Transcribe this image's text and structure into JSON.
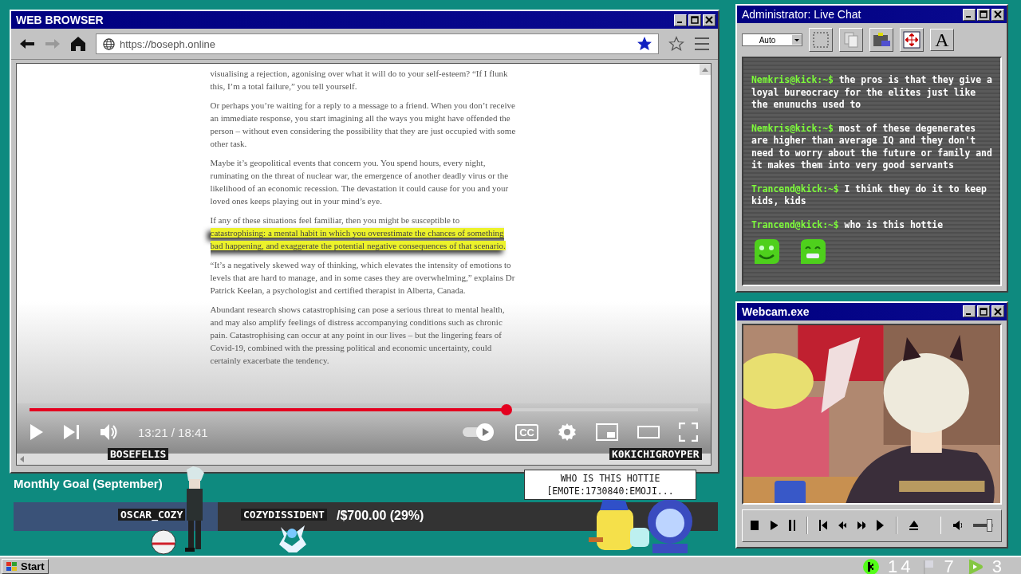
{
  "browser": {
    "title": "WEB BROWSER",
    "url": "https://boseph.online",
    "bookmarked": true,
    "article": [
      {
        "text": "visualising a rejection, agonising over what it will do to your self-esteem? “If I flunk this, I’m a total failure,” you tell yourself."
      },
      {
        "text": "Or perhaps you’re waiting for a reply to a message to a friend. When you don’t receive an immediate response, you start imagining all the ways you might have offended the person – without even considering the possibility that they are just occupied with some other task."
      },
      {
        "text": "Maybe it’s geopolitical events that concern you. You spend hours, every night, ruminating on the threat of nuclear war, the emergence of another deadly virus or the likelihood of an economic recession. The devastation it could cause for you and your loved ones keeps playing out in your mind’s eye."
      },
      {
        "text": "If any of these situations feel familiar, then you might be susceptible to",
        "highlight": "catastrophising: a mental habit in which you overestimate the chances of something bad happening, and exaggerate the potential negative consequences of that scenario."
      },
      {
        "text": "“It’s a negatively skewed way of thinking, which elevates the intensity of emotions to levels that are hard to manage, and in some cases they are overwhelming,” explains Dr Patrick Keelan, a psychologist and certified therapist in Alberta, Canada."
      },
      {
        "text": "Abundant research shows catastrophising can pose a serious threat to mental health, and may also amplify feelings of distress accompanying conditions such as chronic pain. Catastrophising can occur at any point in our lives – but the lingering fears of Covid-19, combined with the pressing political and economic uncertainty, could certainly exacerbate the tendency."
      }
    ],
    "player": {
      "level": 0.714,
      "time": "13:21 / 18:41",
      "autoplay": true,
      "captions_label": "CC"
    }
  },
  "chat": {
    "title": "Administrator: Live Chat",
    "font_size": "Auto",
    "font_button": "A",
    "messages": [
      {
        "user": "Nemkris@kick:~$",
        "text": "the pros is that they give a loyal bureocracy for the elites just like the enunuchs used to"
      },
      {
        "user": "Nemkris@kick:~$",
        "text": "most of these degenerates are higher than average IQ and they don't need to worry about the future or family and it makes them into very good servants"
      },
      {
        "user": "Trancend@kick:~$",
        "text": "I think they do it to keep kids, kids"
      },
      {
        "user": "Trancend@kick:~$",
        "text": "who is this hottie",
        "emotes": [
          {
            "kind": "smile"
          },
          {
            "kind": "grimace"
          }
        ]
      }
    ]
  },
  "webcam": {
    "title": "Webcam.exe",
    "volume": {
      "level": 0.8
    }
  },
  "goal": {
    "title": "Monthly Goal (September)",
    "amount": "/$700.00 (29%)",
    "level": 0.29
  },
  "overlay": {
    "names": [
      {
        "kind": "figure",
        "name": "BOSEFELIS"
      },
      {
        "kind": "ball",
        "name": "OSCAR_COZY"
      },
      {
        "kind": "sprite",
        "name": "COZYDISSIDENT"
      },
      {
        "kind": "critter",
        "name": "K0KICHIGROYPER"
      }
    ],
    "bubble": "WHO IS THIS HOTTIE [EMOTE:1730840:EMOJI..."
  },
  "taskbar": {
    "start": "Start",
    "counters": [
      {
        "kind": "kick",
        "count": "14"
      },
      {
        "kind": "cozy",
        "count": "7"
      },
      {
        "kind": "rumble",
        "count": "3"
      }
    ]
  }
}
